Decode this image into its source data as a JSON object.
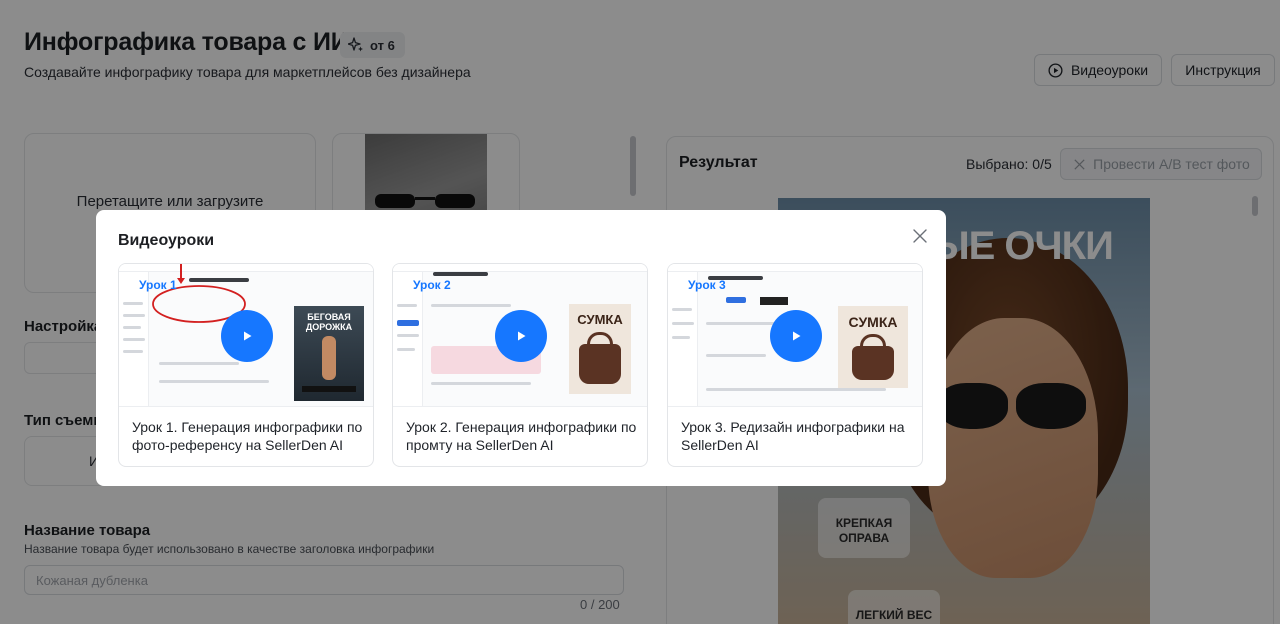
{
  "page": {
    "title": "Инфографика товара с ИИ",
    "cost_badge": "от 6",
    "subtitle": "Создавайте инфографику товара для маркетплейсов без дизайнера",
    "buttons": {
      "video_lessons": "Видеоуроки",
      "instruction": "Инструкция"
    },
    "upload": {
      "text": "Перетащите или загрузите изображение"
    },
    "sections": {
      "settings": "Настройка",
      "shoot_type": "Тип съемк",
      "shoot_type_option": "И"
    },
    "product_name": {
      "label": "Название товара",
      "hint": "Название товара будет использовано в качестве заголовка инфографики",
      "placeholder": "Кожаная дубленка",
      "counter": "0 / 200"
    },
    "result": {
      "title": "Результат",
      "selected": "Выбрано: 0/5",
      "ab_test_button": "Провести A/B тест фото",
      "preview": {
        "headline": "ЦИТНЫЕ ОЧКИ",
        "feature_1": "КРЕПКАЯ ОПРАВА",
        "feature_2": "ЛЕГКИЙ ВЕС"
      }
    }
  },
  "modal": {
    "title": "Видеоуроки",
    "close_icon": "close-icon",
    "lessons": [
      {
        "tag": "Урок 1",
        "caption": "Урок 1. Генерация инфографики по фото-референсу на SellerDen AI",
        "poster_text": "БЕГОВАЯ ДОРОЖКА"
      },
      {
        "tag": "Урок 2",
        "caption": "Урок 2. Генерация инфографики по промту на SellerDen AI",
        "poster_text": "СУМКА"
      },
      {
        "tag": "Урок 3",
        "caption": "Урок 3. Редизайн инфографики на SellerDen AI",
        "poster_text": "СУМКА"
      }
    ]
  },
  "colors": {
    "accent": "#1677ff",
    "overlay": "rgba(0,0,0,0.45)"
  }
}
